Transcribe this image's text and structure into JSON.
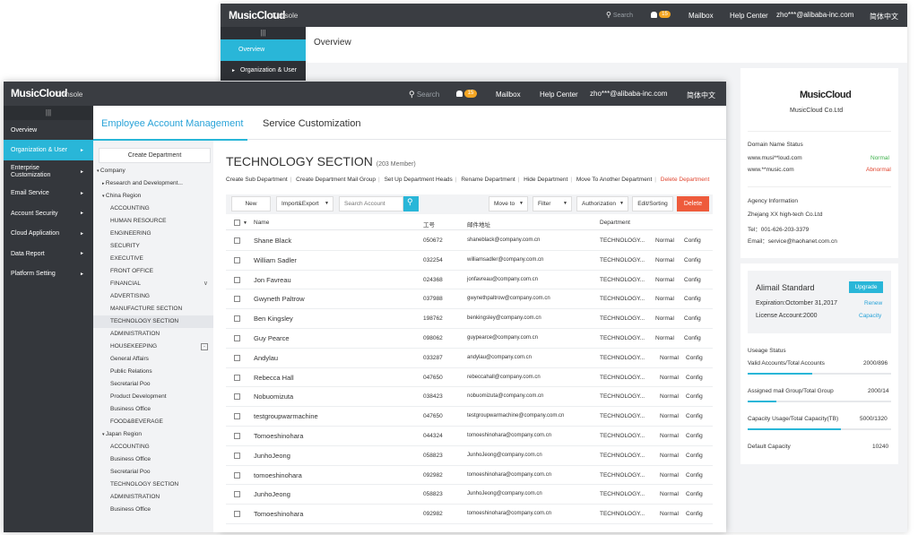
{
  "app": {
    "logo": "MusicCloud",
    "console": "Console"
  },
  "topbar": {
    "search": "Search",
    "badge": "15",
    "mailbox": "Mailbox",
    "help": "Help Center",
    "user": "zho***@alibaba-inc.com",
    "lang": "简体中文"
  },
  "back": {
    "menu_toggle": "|||",
    "side_overview": "Overview",
    "side_org": "Organization & User",
    "overview_title": "Overview",
    "company": {
      "logo": "MusicCloud",
      "name": "MusicCloud Co.Ltd"
    },
    "domain": {
      "header": "Domain  Name  Status",
      "rows": [
        {
          "name": "www.musi**loud.com",
          "status": "Normal"
        },
        {
          "name": "www.**music.com",
          "status": "Abnormal"
        }
      ]
    },
    "agency": {
      "header": "Agency  Information",
      "lines": [
        "Zhejang XX high-tech Co.Ltd",
        "Tel：001-626-203-3379",
        "Email：service@haohanet.com.cn"
      ]
    },
    "plan": {
      "name": "Alimail  Standard",
      "upgrade": "Upgrade",
      "expiration": "Expiration:Octomber 31,2017",
      "renew": "Renew",
      "license": "License  Account:2000",
      "capacity_link": "Capacity"
    },
    "usage": {
      "header": "Useage  Status",
      "rows": [
        {
          "label": "Valid Accounts/Total Accounts",
          "value": "2000/896",
          "fill": 0.45
        },
        {
          "label": "Assigned mail Group/Total Group",
          "value": "2000/14",
          "fill": 0.2
        },
        {
          "label": "Capacity Usage/Total Capacity(TB)",
          "value": "5000/1320",
          "fill": 0.65
        },
        {
          "label": "Default Capacity",
          "value": "10240",
          "fill": null
        }
      ]
    }
  },
  "nav": {
    "toggle": "|||",
    "items": [
      "Overview",
      "Organization & User",
      "Enterprise Customization",
      "Email Service",
      "Account Security",
      "Cloud Application",
      "Data Report",
      "Platform Setting"
    ]
  },
  "tabs": [
    "Employee  Account  Management",
    "Service  Customization"
  ],
  "tree": {
    "create": "Create  Department",
    "company": "Company",
    "research": "Research and Development...",
    "china": "China Region",
    "china_items": [
      "ACCOUNTING",
      "HUMAN RESOURCE",
      "ENGINEERING",
      "SECURITY",
      "EXECUTIVE",
      "FRONT OFFICE",
      "FINANCIAL",
      "ADVERTISING",
      "MANUFACTURE SECTION",
      "TECHNOLOGY SECTION",
      "ADMINISTRATION",
      "HOUSEKEEPING",
      "General Affairs",
      "Public Relations",
      "Secretarial Poo",
      "Product Development",
      "Business Office",
      "FOOD&BEVERAGE"
    ],
    "japan": "Japan Region",
    "japan_items": [
      "ACCOUNTING",
      "Business Office",
      "Secretarial Poo",
      "TECHNOLOGY SECTION",
      "ADMINISTRATION",
      "Business Office"
    ]
  },
  "main": {
    "title": "TECHNOLOGY SECTION",
    "member_count": "(203 Member)",
    "actions": [
      "Create Sub Department",
      "Create Department Mail Group",
      "Set Up Department Heads",
      "Rename Department",
      "Hide Department",
      "Move To Another Department",
      "Delete Department"
    ],
    "toolbar": {
      "new": "New",
      "import": "Import&Export",
      "search_placeholder": "Search Account",
      "move": "Move to",
      "filter": "Filter",
      "auth": "Authorization",
      "edit": "Edit/Sorting",
      "delete": "Delete"
    },
    "columns": {
      "name": "Name",
      "id": "工号",
      "email": "邮件地址",
      "dept": "Department"
    },
    "rows": [
      {
        "name": "Shane Black",
        "id": "050672",
        "email": "shaneblack@company.com.cn",
        "dept": "TECHNOLOGY...",
        "status": "Normal",
        "action": "Config"
      },
      {
        "name": "William Sadler",
        "id": "032254",
        "email": "williamsadler@company.com.cn",
        "dept": "TECHNOLOGY...",
        "status": "Normal",
        "action": "Config"
      },
      {
        "name": "Jon Favreau",
        "id": "024368",
        "email": "jonfavreau@company.com.cn",
        "dept": "TECHNOLOGY...",
        "status": "Normal",
        "action": "Config"
      },
      {
        "name": "Gwyneth Paltrow",
        "id": "037988",
        "email": "gwynethpaltrow@company.com.cn",
        "dept": "TECHNOLOGY...",
        "status": "Normal",
        "action": "Config"
      },
      {
        "name": "Ben Kingsley",
        "id": "198762",
        "email": "benkingsley@company.com.cn",
        "dept": "TECHNOLOGY...",
        "status": "Normal",
        "action": "Config"
      },
      {
        "name": "Guy Pearce",
        "id": "098062",
        "email": "guypearce@company.com.cn",
        "dept": "TECHNOLOGY...",
        "status": "Normal",
        "action": "Config"
      },
      {
        "name": "Andylau",
        "id": "033287",
        "email": "andylau@company.com.cn",
        "dept": "TECHNOLOGY...",
        "status": "Normal",
        "action": "Config"
      },
      {
        "name": "Rebecca Hall",
        "id": "047650",
        "email": "rebeccahall@company.com.cn",
        "dept": "TECHNOLOGY...",
        "status": "Normal",
        "action": "Config"
      },
      {
        "name": "Nobuomizuta",
        "id": "038423",
        "email": "nobuomizuta@company.com.cn",
        "dept": "TECHNOLOGY...",
        "status": "Normal",
        "action": "Config"
      },
      {
        "name": "testgroupwarmachine",
        "id": "047650",
        "email": "testgroupwarmachine@company.com.cn",
        "dept": "TECHNOLOGY...",
        "status": "Normal",
        "action": "Config"
      },
      {
        "name": "Tomoeshinohara",
        "id": "044324",
        "email": "tomoeshinohara@company.com.cn",
        "dept": "TECHNOLOGY...",
        "status": "Normal",
        "action": "Config"
      },
      {
        "name": "JunhoJeong",
        "id": "058823",
        "email": "JunhoJeong@company.com.cn",
        "dept": "TECHNOLOGY...",
        "status": "Normal",
        "action": "Config"
      },
      {
        "name": "tomoeshinohara",
        "id": "092982",
        "email": "tomoeshinohara@company.com.cn",
        "dept": "TECHNOLOGY...",
        "status": "Normal",
        "action": "Config"
      },
      {
        "name": "JunhoJeong",
        "id": "058823",
        "email": "JunhoJeong@company.com.cn",
        "dept": "TECHNOLOGY...",
        "status": "Normal",
        "action": "Config"
      },
      {
        "name": "Tomoeshinohara",
        "id": "092982",
        "email": "tomoeshinohara@company.com.cn",
        "dept": "TECHNOLOGY...",
        "status": "Normal",
        "action": "Config"
      }
    ]
  },
  "colors": {
    "accent": "#29b6d8",
    "topbar": "#3a3d42",
    "nav": "#34373c",
    "normal": "#3cb04a",
    "abnormal": "#e0452f",
    "delete": "#ee5b3c"
  }
}
